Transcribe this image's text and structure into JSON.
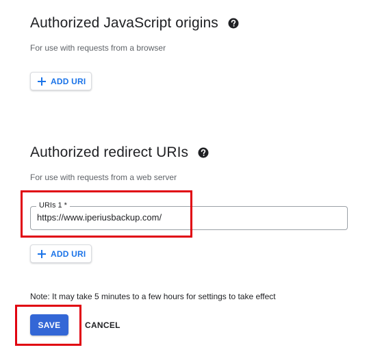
{
  "js_origins": {
    "title": "Authorized JavaScript origins",
    "subtitle": "For use with requests from a browser",
    "add_button_label": "ADD URI"
  },
  "redirect_uris": {
    "title": "Authorized redirect URIs",
    "subtitle": "For use with requests from a web server",
    "field_label": "URIs 1 *",
    "field_value": "https://www.iperiusbackup.com/",
    "add_button_label": "ADD URI"
  },
  "note": "Note: It may take 5 minutes to a few hours for settings to take effect",
  "actions": {
    "save_label": "SAVE",
    "cancel_label": "CANCEL"
  },
  "icons": {
    "help": "help-circle-icon",
    "add": "plus-icon"
  },
  "colors": {
    "accent": "#1a73e8",
    "save_button_bg": "#3367d6",
    "highlight": "#e0000f"
  }
}
